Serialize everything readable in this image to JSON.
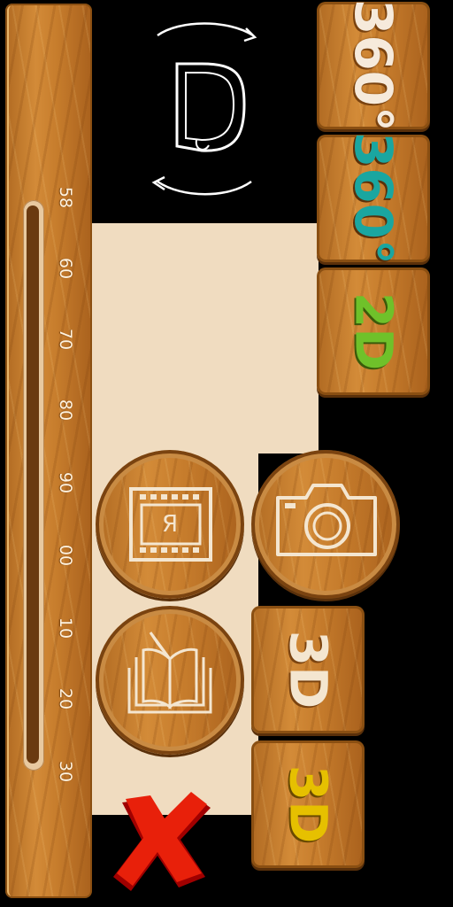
{
  "ruler": {
    "ticks": [
      "58",
      "60",
      "70",
      "80",
      "90",
      "00",
      "10",
      "20",
      "30"
    ]
  },
  "preview": {
    "letter": "D",
    "rotate_icon": "rotate-arrows-icon"
  },
  "buttons": {
    "view360_white": "360°",
    "view360_teal": "360°",
    "view2d": "2D",
    "view3d_white": "3D",
    "view3d_yellow": "3D"
  },
  "round_buttons": {
    "film_letter": "Я",
    "film_icon": "film-frame-icon",
    "camera_icon": "camera-icon",
    "book_icon": "open-book-icon"
  },
  "colors": {
    "wood": "#c67c2c",
    "teal": "#1aa6a0",
    "green": "#6fc12a",
    "yellow": "#e6c000",
    "cream": "#f4e6d0",
    "red": "#e8200a"
  },
  "close": {
    "icon": "close-x-icon"
  }
}
